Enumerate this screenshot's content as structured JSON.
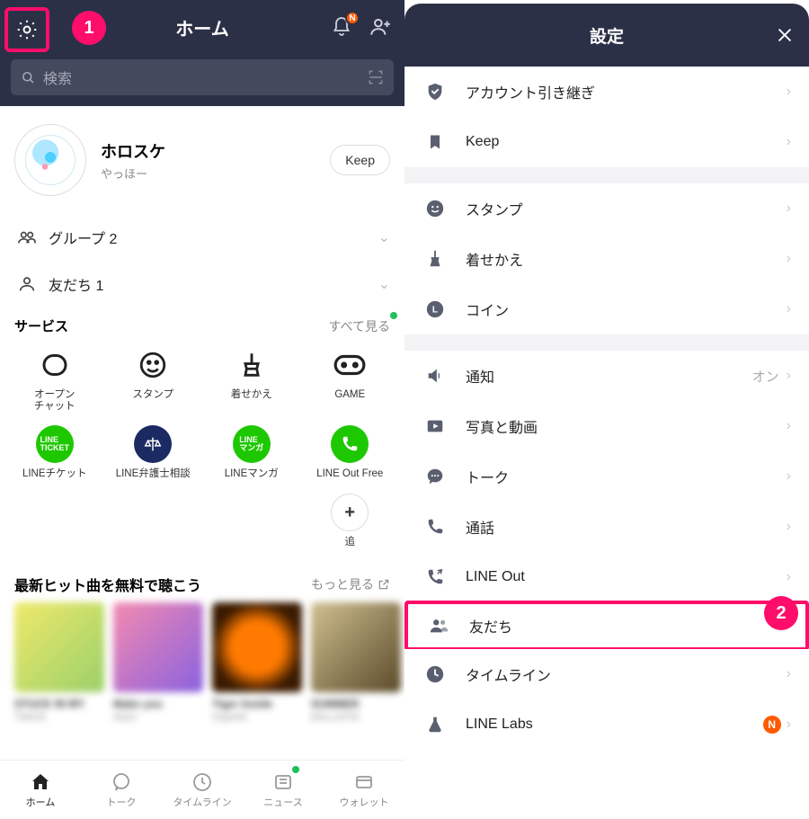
{
  "callouts": {
    "one": "1",
    "two": "2"
  },
  "left": {
    "title": "ホーム",
    "notification_badge": "N",
    "search_placeholder": "検索",
    "profile": {
      "name": "ホロスケ",
      "status": "やっほー",
      "keep_label": "Keep"
    },
    "rows": {
      "groups": {
        "label": "グループ",
        "count": "2"
      },
      "friends": {
        "label": "友だち",
        "count": "1"
      }
    },
    "services": {
      "title": "サービス",
      "see_all": "すべて見る",
      "items": [
        {
          "label": "オープン\nチャット"
        },
        {
          "label": "スタンプ"
        },
        {
          "label": "着せかえ"
        },
        {
          "label": "GAME"
        },
        {
          "label": "LINEチケット",
          "badge": "LINE\nTICKET"
        },
        {
          "label": "LINE弁護士相談"
        },
        {
          "label": "LINEマンガ",
          "badge": "LINE\nマンガ"
        },
        {
          "label": "LINE Out Free"
        },
        {
          "label": "追"
        }
      ]
    },
    "music": {
      "title": "最新ヒット曲を無料で聴こう",
      "more": "もっと見る"
    },
    "tabs": [
      {
        "label": "ホーム"
      },
      {
        "label": "トーク"
      },
      {
        "label": "タイムライン"
      },
      {
        "label": "ニュース"
      },
      {
        "label": "ウォレット"
      }
    ]
  },
  "right": {
    "title": "設定",
    "rows": {
      "account_transfer": "アカウント引き継ぎ",
      "keep": "Keep",
      "stamp": "スタンプ",
      "theme": "着せかえ",
      "coin": "コイン",
      "notification": {
        "label": "通知",
        "value": "オン"
      },
      "photo_video": "写真と動画",
      "talk": "トーク",
      "call": "通話",
      "line_out": "LINE Out",
      "friends": "友だち",
      "timeline": "タイムライン",
      "labs": {
        "label": "LINE Labs",
        "badge": "N"
      }
    }
  }
}
